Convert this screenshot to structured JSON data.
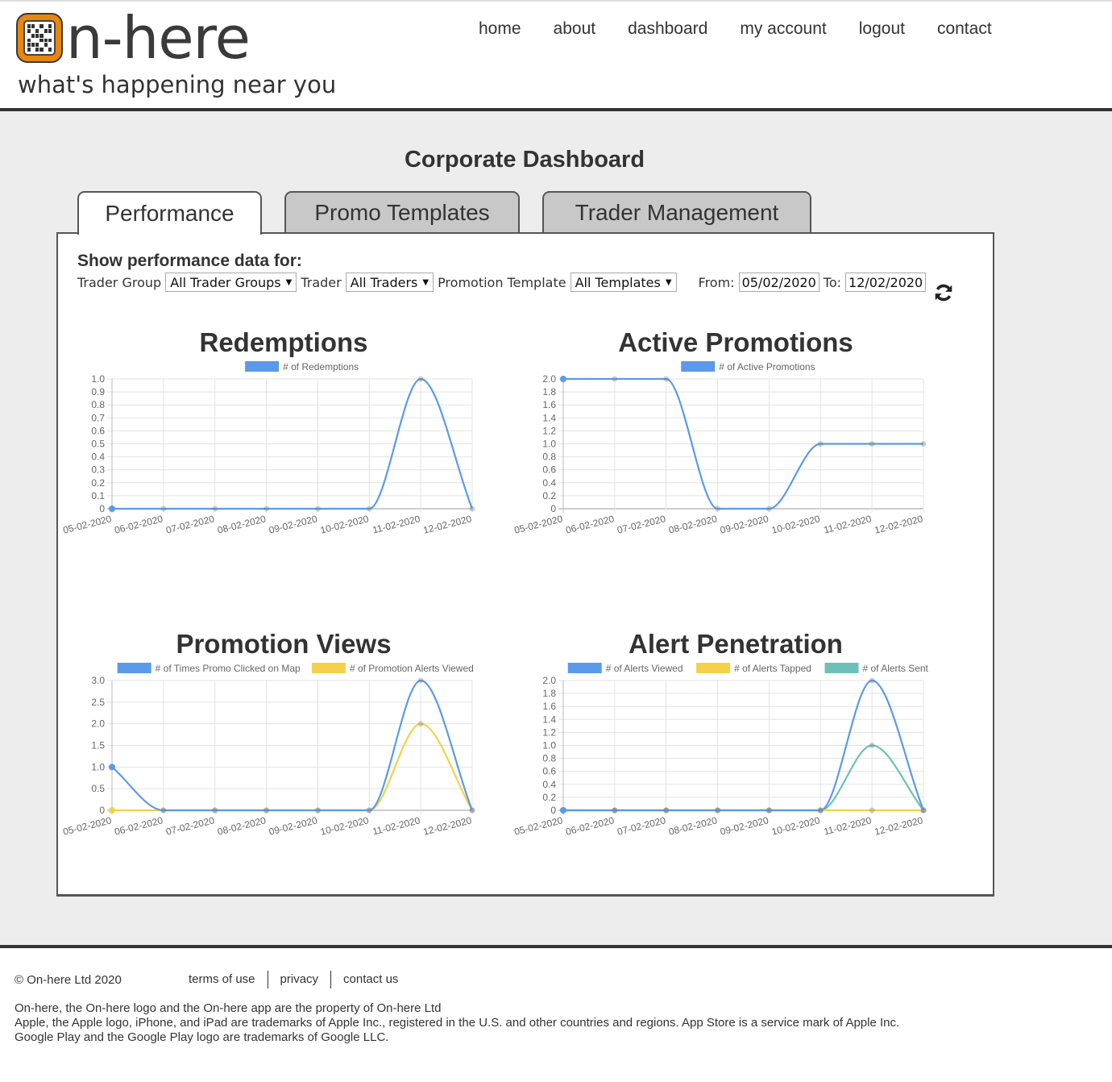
{
  "brand": {
    "logo_text": "n-here",
    "tagline": "what's happening near you",
    "accent": "#e8860e"
  },
  "nav": [
    "home",
    "about",
    "dashboard",
    "my account",
    "logout",
    "contact"
  ],
  "page": {
    "title": "Corporate Dashboard",
    "tabs": [
      {
        "label": "Performance",
        "active": true
      },
      {
        "label": "Promo Templates",
        "active": false
      },
      {
        "label": "Trader Management",
        "active": false
      }
    ]
  },
  "filters": {
    "heading": "Show performance data for:",
    "trader_group_label": "Trader Group",
    "trader_group_value": "All Trader Groups",
    "trader_label": "Trader",
    "trader_value": "All Traders",
    "template_label": "Promotion Template",
    "template_value": "All Templates",
    "from_label": "From:",
    "from_value": "05/02/2020",
    "to_label": "To:",
    "to_value": "12/02/2020",
    "refresh_icon": "refresh-icon"
  },
  "chart_data": [
    {
      "type": "line",
      "title": "Redemptions",
      "categories": [
        "05-02-2020",
        "06-02-2020",
        "07-02-2020",
        "08-02-2020",
        "09-02-2020",
        "10-02-2020",
        "11-02-2020",
        "12-02-2020"
      ],
      "ylim": [
        0,
        1.0
      ],
      "yticks": [
        "0",
        "0.1",
        "0.2",
        "0.3",
        "0.4",
        "0.5",
        "0.6",
        "0.7",
        "0.8",
        "0.9",
        "1.0"
      ],
      "grid": true,
      "legend": "top-center",
      "series": [
        {
          "name": "# of Redemptions",
          "color": "#5a9ae8",
          "values": [
            0,
            0,
            0,
            0,
            0,
            0,
            1,
            0
          ]
        }
      ]
    },
    {
      "type": "line",
      "title": "Active Promotions",
      "categories": [
        "05-02-2020",
        "06-02-2020",
        "07-02-2020",
        "08-02-2020",
        "09-02-2020",
        "10-02-2020",
        "11-02-2020",
        "12-02-2020"
      ],
      "ylim": [
        0,
        2.0
      ],
      "yticks": [
        "0",
        "0.2",
        "0.4",
        "0.6",
        "0.8",
        "1.0",
        "1.2",
        "1.4",
        "1.6",
        "1.8",
        "2.0"
      ],
      "grid": true,
      "legend": "top-center",
      "series": [
        {
          "name": "# of Active Promotions",
          "color": "#5a9ae8",
          "values": [
            2,
            2,
            2,
            0,
            0,
            1,
            1,
            1
          ]
        }
      ]
    },
    {
      "type": "line",
      "title": "Promotion Views",
      "categories": [
        "05-02-2020",
        "06-02-2020",
        "07-02-2020",
        "08-02-2020",
        "09-02-2020",
        "10-02-2020",
        "11-02-2020",
        "12-02-2020"
      ],
      "ylim": [
        0,
        3.0
      ],
      "yticks": [
        "0",
        "0.5",
        "1.0",
        "1.5",
        "2.0",
        "2.5",
        "3.0"
      ],
      "grid": true,
      "legend": "top-center",
      "series": [
        {
          "name": "# of Times Promo Clicked on Map",
          "color": "#5a9ae8",
          "values": [
            1,
            0,
            0,
            0,
            0,
            0,
            3,
            0
          ]
        },
        {
          "name": "# of Promotion Alerts Viewed",
          "color": "#f5d04a",
          "values": [
            0,
            0,
            0,
            0,
            0,
            0,
            2,
            0
          ]
        }
      ]
    },
    {
      "type": "line",
      "title": "Alert Penetration",
      "categories": [
        "05-02-2020",
        "06-02-2020",
        "07-02-2020",
        "08-02-2020",
        "09-02-2020",
        "10-02-2020",
        "11-02-2020",
        "12-02-2020"
      ],
      "ylim": [
        0,
        2.0
      ],
      "yticks": [
        "0",
        "0.2",
        "0.4",
        "0.6",
        "0.8",
        "1.0",
        "1.2",
        "1.4",
        "1.6",
        "1.8",
        "2.0"
      ],
      "grid": true,
      "legend": "top-center",
      "series": [
        {
          "name": "# of Alerts Viewed",
          "color": "#5a9ae8",
          "values": [
            0,
            0,
            0,
            0,
            0,
            0,
            2,
            0
          ]
        },
        {
          "name": "# of Alerts Tapped",
          "color": "#f5d04a",
          "values": [
            0,
            0,
            0,
            0,
            0,
            0,
            0,
            0
          ]
        },
        {
          "name": "# of Alerts Sent",
          "color": "#6cc0b8",
          "values": [
            0,
            0,
            0,
            0,
            0,
            0,
            1,
            0
          ]
        }
      ]
    }
  ],
  "footer": {
    "copyright": "© On-here Ltd 2020",
    "links": [
      "terms of use",
      "privacy",
      "contact us"
    ],
    "legal": [
      "On-here, the On-here logo and the On-here app are the property of On-here Ltd",
      "Apple, the Apple logo, iPhone, and iPad are trademarks of Apple Inc., registered in the U.S. and other countries and regions. App Store is a service mark of Apple Inc.",
      "Google Play and the Google Play logo are trademarks of Google LLC."
    ]
  }
}
